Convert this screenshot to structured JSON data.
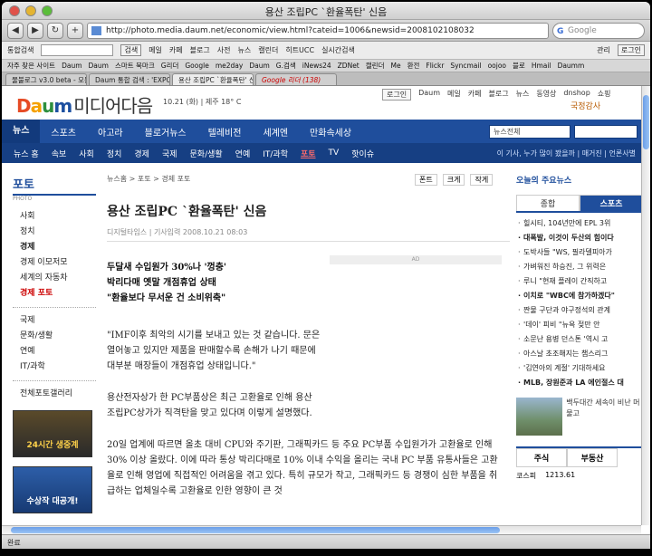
{
  "window": {
    "title": "용산 조립PC `환율폭탄' 신음"
  },
  "toolbar": {
    "url": "http://photo.media.daum.net/economic/view.html?cateid=1006&newsid=2008102108032",
    "search_placeholder": "Google"
  },
  "daumbar": {
    "items": [
      "통합검색",
      "검색",
      "메일",
      "카페",
      "블로그",
      "사전",
      "뉴스",
      "캘린더",
      "히트UCC",
      "실시간검색",
      "관리",
      "로그인"
    ]
  },
  "bookmarks": [
    "자주 찾은 사이트",
    "Daum",
    "Daum",
    "스마트 북마크",
    "G리더",
    "Google",
    "me2day",
    "Daum",
    "G.검색",
    "iNews24",
    "ZDNet",
    "캘린더",
    "Me",
    "환전",
    "Flickr",
    "Syncmail",
    "oojoo",
    "블로",
    "Hmail",
    "Daumm"
  ],
  "tabs": [
    {
      "label": "물불로그 v3.0 beta - 모든 블로..."
    },
    {
      "label": "Daum 통합 검색 : 'EXPO COMM ..."
    },
    {
      "label": "용산 조립PC `환율폭탄' 신음"
    },
    {
      "label": "Google 리더 (138)"
    }
  ],
  "page": {
    "top_links": [
      "로그인",
      "Daum",
      "메일",
      "카페",
      "블로그",
      "뉴스",
      "동영상",
      "dnshop",
      "쇼핑"
    ],
    "logo": {
      "d": "D",
      "a": "a",
      "u": "u",
      "m": "m",
      "media": "미디어다음"
    },
    "date_weather": "10.21 (화) | 제주 18° C",
    "ad_top": "국정감사",
    "nav1": [
      "뉴스",
      "스포츠",
      "아고라",
      "블로거뉴스",
      "텔레비전",
      "세계엔",
      "만화속세상"
    ],
    "search_select": "뉴스전체",
    "nav2": [
      "뉴스 홈",
      "속보",
      "사회",
      "정치",
      "경제",
      "국제",
      "문화/생활",
      "연예",
      "IT/과학",
      "포토",
      "TV",
      "핫이슈"
    ],
    "nav2_right": "이 기사, 누가 많이 봤을까 | 매거진 | 언론사별",
    "left": {
      "head": "포토",
      "sub": "PHOTO",
      "group1": [
        "사회",
        "정치",
        "경제"
      ],
      "group2": [
        "경제 이모저모",
        "세계의 자동차",
        "경제 포토"
      ],
      "group3": [
        "국제",
        "문화/생활",
        "연예",
        "IT/과학"
      ],
      "gallery": "전체포토갤러리",
      "banner1": "24시간 생중계",
      "banner2": "수상작 대공개!"
    },
    "article": {
      "breadcrumb": "뉴스홈 > 포토 > 경제 포토",
      "tools": [
        "폰트",
        "크게",
        "작게"
      ],
      "title": "용산 조립PC `환율폭탄' 신음",
      "meta": "디지털타임스 | 기사입력 2008.10.21 08:03",
      "ad_label": "AD",
      "subhead": [
        "두달새 수입원가 30%나 '껑충'",
        "박리다매 옛말 개점휴업 상태",
        "\"환율보다 무서운 건 소비위축\""
      ],
      "p1": "\"IMF이후 최악의 시기를 보내고 있는 것 같습니다. 문은 열어놓고 있지만 제품을 판매할수록 손해가 나기 때문에 대부분 매장들이 개점휴업 상태입니다.\"",
      "p2": "용산전자상가 한 PC부품상은 최근 고환율로 인해 용산 조립PC상가가 직격탄을 맞고 있다며 이렇게 설명했다.",
      "p3": "20일 업계에 따르면 올초 대비 CPU와 주기판, 그래픽카드 등 주요 PC부품 수입원가가 고환율로 인해 30% 이상 올랐다. 이에 따라 통상 박리다매로 10% 이내 수익을 올리는 국내 PC 부품 유통사들은 고환율로 인해 영업에 직접적인 어려움을 겪고 있다. 특히 규모가 작고, 그래픽카드 등 경쟁이 심한 부품을 취급하는 업체일수록 고환율로 인한 영향이 큰 것"
    },
    "right": {
      "head": "오늘의 주요뉴스",
      "tabs": [
        "종합",
        "스포츠"
      ],
      "list": [
        "힐시티, 104년만에 EPL 3위",
        "대폭발, 이것이 두산의 힘이다",
        "도박사들 \"WS, 필라델피아가",
        "가벼워진 하승진, 그 위력은",
        "루니 \"현재 플레이 간직하고",
        "이치로 \"WBC에 참가하겠다\"",
        "짠물 구단과 야구정석의 관계",
        "'데이' 피비 \"뉴욕 젖만 안 ",
        "소문난 용병 던스톤 '역시 고",
        "아스날 초조해지는 챔스리그",
        "'김연아의 계절' 기대하세요",
        "MLB, 장원준과 LA 에인절스 대"
      ],
      "photo_caption": "백두대간 세속이 비난 머물고",
      "stock_tabs": [
        "주식",
        "부동산"
      ],
      "kospi_label": "코스피",
      "kospi_value": "1213.61"
    }
  },
  "status": {
    "text": "완료"
  }
}
